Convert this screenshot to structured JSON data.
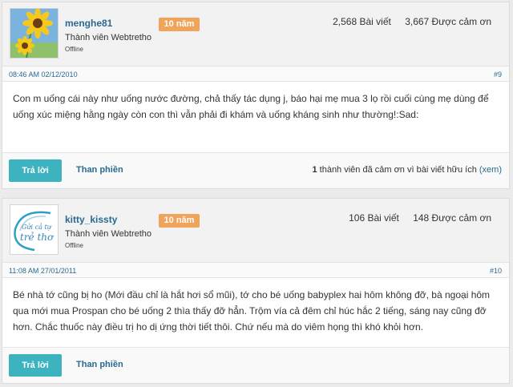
{
  "posts": [
    {
      "username": "menghe81",
      "badge": "10 năm",
      "rank": "Thành viên Webtretho",
      "status": "Offline",
      "post_count": "2,568 Bài viết",
      "thanked": "3,667 Được cảm ơn",
      "datetime": "08:46 AM 02/12/2010",
      "number": "#9",
      "body": "Con m uống cái này như uống nước đường, chả thấy tác dụng j, báo hại mẹ mua 3 lọ rồi cuối cùng mẹ dùng để uống xúc miệng hằng ngày còn con thì vẫn phải đi khám và uống kháng sinh như thường!:Sad:",
      "reply_label": "Trả lời",
      "report_label": "Than phiền",
      "thanks_count": "1",
      "thanks_text": " thành viên đã cảm ơn vì bài viết hữu ích ",
      "thanks_link": "(xem)"
    },
    {
      "username": "kitty_kissty",
      "badge": "10 năm",
      "rank": "Thành viên Webtretho",
      "status": "Offline",
      "post_count": "106 Bài viết",
      "thanked": "148 Được cảm ơn",
      "datetime": "11:08 AM 27/01/2011",
      "number": "#10",
      "body": "Bé nhà tớ cũng bị ho (Mới đầu chỉ là hắt hơi sổ mũi), tớ cho bé uống babyplex hai hôm không đỡ, bà ngoại hôm qua mới mua Prospan cho bé uống 2 thìa thấy đỡ hẳn. Trộm vía cả đêm chỉ húc hắc 2 tiếng, sáng nay cũng đỡ hơn. Chắc thuốc này điều trị ho dị ứng thời tiết thôi. Chứ nếu mà do viêm họng thì khó khỏi hơn.",
      "reply_label": "Trả lời",
      "report_label": "Than phiền"
    }
  ],
  "colors": {
    "accent": "#3db3c0",
    "badge": "#f0a35a",
    "link": "#2a6a8e"
  },
  "icons": {
    "avatar_1": "sunflower-avatar",
    "avatar_2": "tre-tho-logo-avatar"
  }
}
